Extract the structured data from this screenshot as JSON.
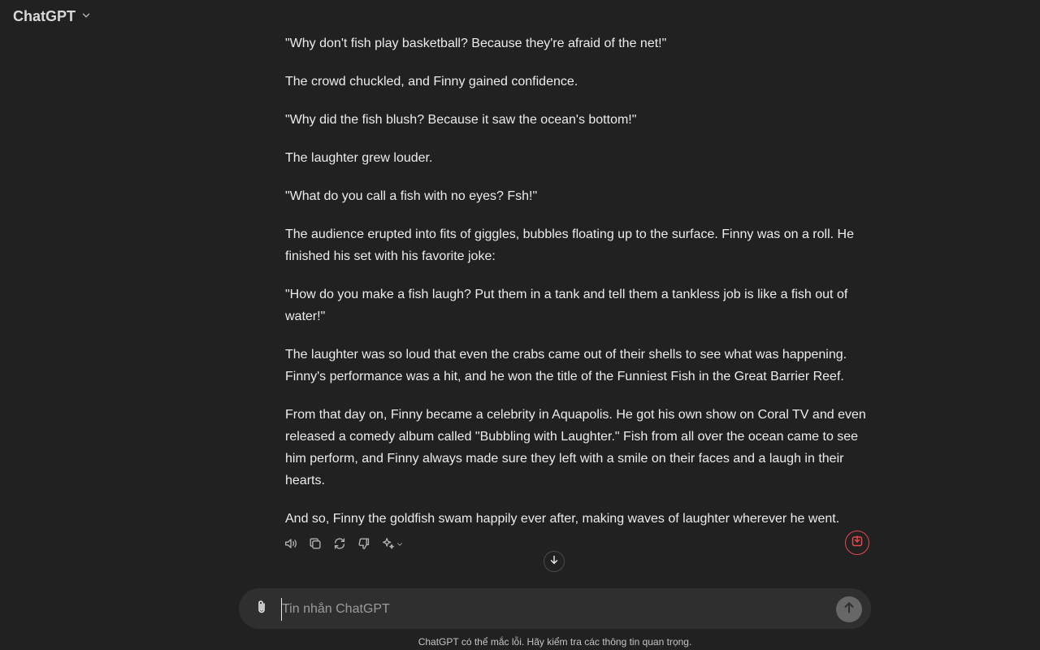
{
  "header": {
    "model_name": "ChatGPT"
  },
  "message": {
    "paragraphs": [
      "\"Why don't fish play basketball? Because they're afraid of the net!\"",
      "The crowd chuckled, and Finny gained confidence.",
      "\"Why did the fish blush? Because it saw the ocean's bottom!\"",
      "The laughter grew louder.",
      "\"What do you call a fish with no eyes? Fsh!\"",
      "The audience erupted into fits of giggles, bubbles floating up to the surface. Finny was on a roll. He finished his set with his favorite joke:",
      "\"How do you make a fish laugh? Put them in a tank and tell them a tankless job is like a fish out of water!\"",
      "The laughter was so loud that even the crabs came out of their shells to see what was happening. Finny's performance was a hit, and he won the title of the Funniest Fish in the Great Barrier Reef.",
      "From that day on, Finny became a celebrity in Aquapolis. He got his own show on Coral TV and even released a comedy album called \"Bubbling with Laughter.\" Fish from all over the ocean came to see him perform, and Finny always made sure they left with a smile on their faces and a laugh in their hearts.",
      "And so, Finny the goldfish swam happily ever after, making waves of laughter wherever he went."
    ]
  },
  "actions": {
    "icons": [
      "speaker-icon",
      "copy-icon",
      "regenerate-icon",
      "thumbs-down-icon",
      "sparkle-icon"
    ]
  },
  "composer": {
    "placeholder": "Tin nhắn ChatGPT",
    "value": ""
  },
  "footer": {
    "disclaimer": "ChatGPT có thể mắc lỗi. Hãy kiểm tra các thông tin quan trọng."
  },
  "colors": {
    "background": "#212121",
    "composer": "#2f2f2f",
    "accent_red": "#e5484d",
    "text": "#ececec"
  }
}
